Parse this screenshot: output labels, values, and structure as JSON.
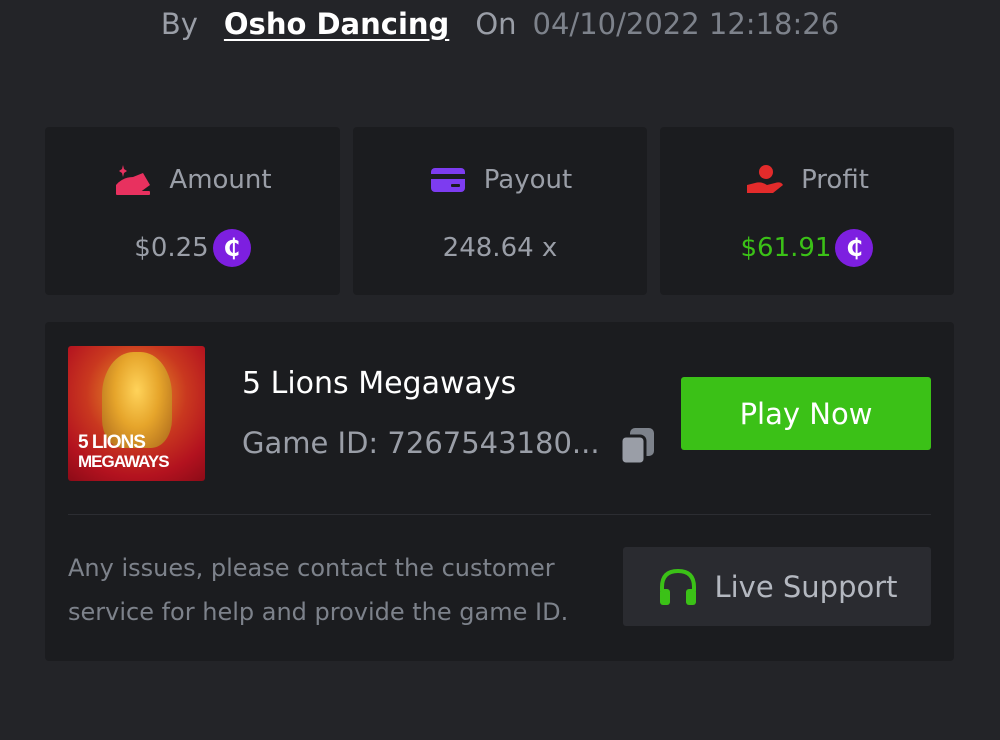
{
  "byline": {
    "by_label": "By",
    "user": "Osho Dancing",
    "on_label": "On",
    "datetime": "04/10/2022 12:18:26"
  },
  "stats": {
    "amount": {
      "label": "Amount",
      "value": "$0.25",
      "icon": "amount-icon",
      "color": "#9a9ea7",
      "icon_color": "#e8315f"
    },
    "payout": {
      "label": "Payout",
      "value": "248.64 x",
      "icon": "payout-card-icon",
      "color": "#9a9ea7",
      "icon_color": "#7d3cf0"
    },
    "profit": {
      "label": "Profit",
      "value": "$61.91",
      "icon": "profit-hand-icon",
      "color": "#3bc117",
      "icon_color": "#e32b2b"
    }
  },
  "currency_symbol": "₵",
  "game": {
    "title": "5 Lions Megaways",
    "id_label": "Game ID: 7267543180...",
    "thumb_line1": "5 LIONS",
    "thumb_line2": "MEGAWAYS",
    "play_label": "Play Now"
  },
  "support": {
    "message": "Any issues, please contact the customer service for help and provide the game ID.",
    "button_label": "Live Support"
  },
  "colors": {
    "background": "#232428",
    "card": "#1b1c1f",
    "accent_green": "#3bc117",
    "coin_purple": "#7d1fe0"
  }
}
